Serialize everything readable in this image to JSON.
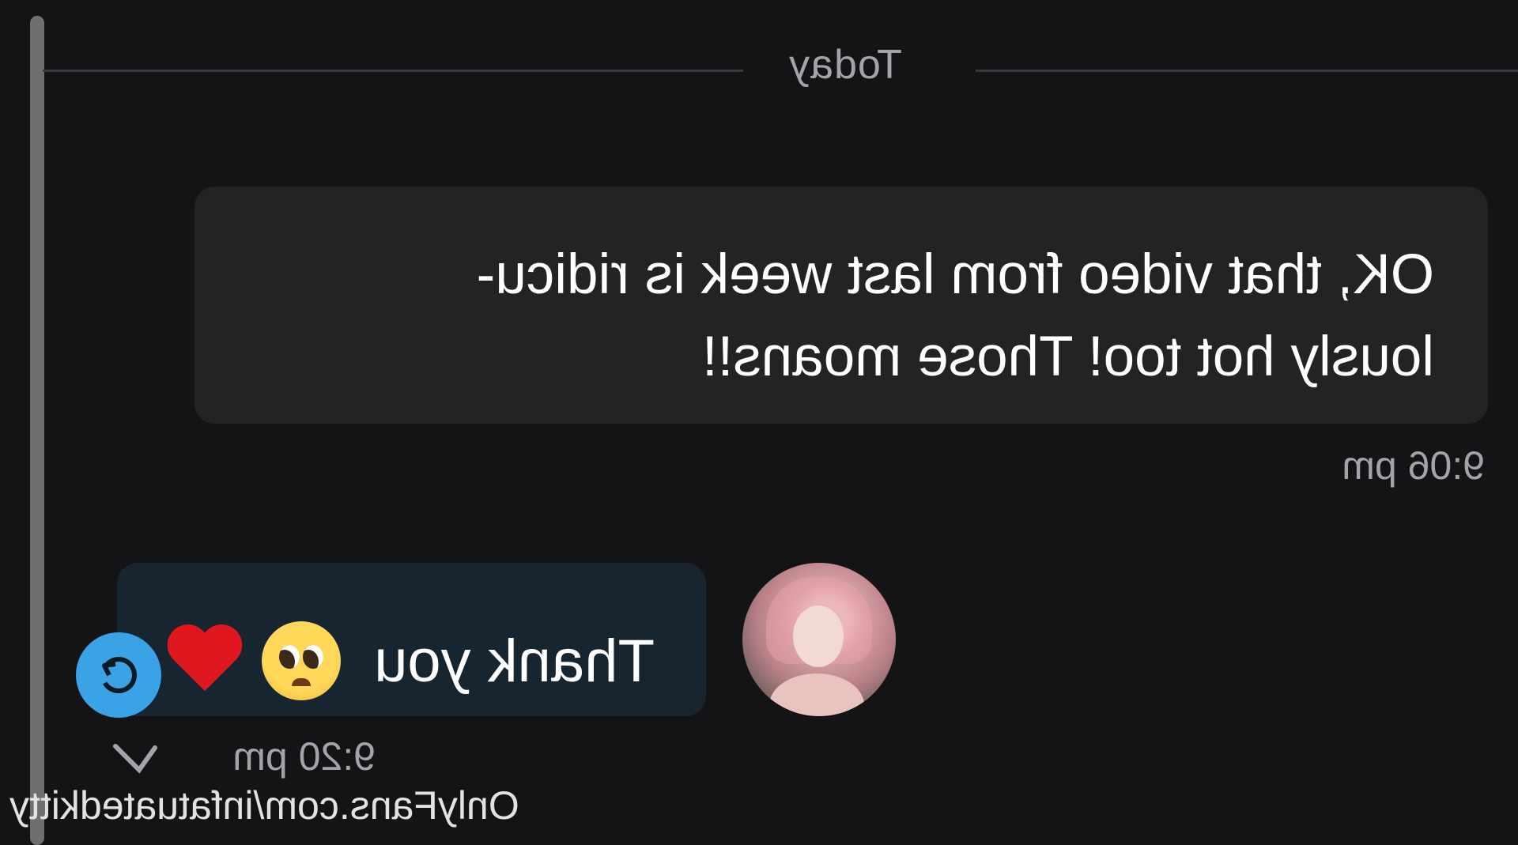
{
  "date_separator": {
    "label": "Today"
  },
  "messages": {
    "outgoing": {
      "lines": [
        "OK, that video from last week is ridicu-",
        "lously hot too! Those moans!!"
      ],
      "time": "9:06 pm"
    },
    "incoming": {
      "text": "Thank you",
      "emojis": [
        "pleading-face-emoji",
        "red-heart-emoji"
      ],
      "time": "9:20 pm"
    }
  },
  "icons": {
    "reply": "reply-icon",
    "read_receipt": "checkmark-icon"
  },
  "watermark": {
    "text": "OnlyFans.com/infatuatedkitty"
  },
  "colors": {
    "background": "#141416",
    "outgoing_bubble": "#232326",
    "incoming_bubble": "#172530",
    "accent_blue": "#3aa3e6",
    "muted_text": "#a4a4a8"
  }
}
